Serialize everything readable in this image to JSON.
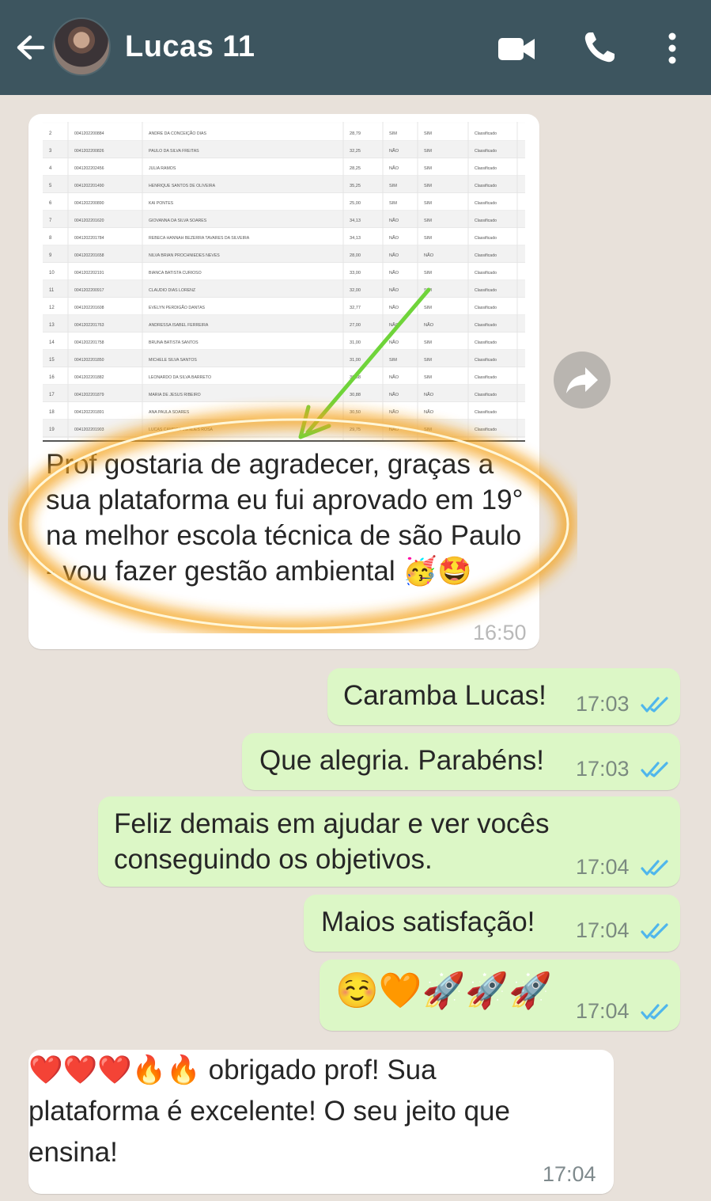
{
  "header": {
    "contact_name": "Lucas 11",
    "back_icon": "arrow-left-icon",
    "video_icon": "video-camera-icon",
    "call_icon": "phone-icon",
    "menu_icon": "more-vertical-icon",
    "bar_color": "#3d555f"
  },
  "messages": [
    {
      "direction": "incoming",
      "has_image": true,
      "text": "Prof gostaria de agradecer, graças a sua plataforma eu fui aprovado em 19° na melhor escola técnica de são Paulo - vou fazer gestão ambiental 🥳🤩",
      "time": "16:50"
    },
    {
      "direction": "outgoing",
      "text": "Caramba Lucas!",
      "time": "17:03",
      "status": "read"
    },
    {
      "direction": "outgoing",
      "text": "Que alegria. Parabéns!",
      "time": "17:03",
      "status": "read"
    },
    {
      "direction": "outgoing",
      "text": "Feliz demais em ajudar e ver vocês conseguindo os objetivos.",
      "time": "17:04",
      "status": "read"
    },
    {
      "direction": "outgoing",
      "text": "Maios satisfação!",
      "time": "17:04",
      "status": "read"
    },
    {
      "direction": "outgoing",
      "text": "☺️🧡🚀🚀🚀",
      "time": "17:04",
      "status": "read"
    },
    {
      "direction": "incoming",
      "text": "❤️❤️❤️🔥🔥 obrigado prof! Sua plataforma é excelente! O seu jeito que ensina!",
      "time": "17:04"
    }
  ],
  "screenshot_table": {
    "rows": [
      [
        "2",
        "0041202200884",
        "ANDRE DA CONCEIÇÃO DIAS",
        "28,79",
        "SIM",
        "SIM",
        "Classificado"
      ],
      [
        "3",
        "0041202200826",
        "PAULO DA SILVA FREITAS",
        "32,25",
        "NÃO",
        "SIM",
        "Classificado"
      ],
      [
        "4",
        "0041202202456",
        "JULIA RAMOS",
        "28,25",
        "NÃO",
        "SIM",
        "Classificado"
      ],
      [
        "5",
        "0041202201490",
        "HENRIQUE SANTOS DE OLIVEIRA",
        "35,25",
        "SIM",
        "SIM",
        "Classificado"
      ],
      [
        "6",
        "0041202200890",
        "KAI PONTES",
        "25,00",
        "SIM",
        "SIM",
        "Classificado"
      ],
      [
        "7",
        "0041202201620",
        "GIOVANNA DA SILVA SOARES",
        "34,13",
        "NÃO",
        "SIM",
        "Classificado"
      ],
      [
        "8",
        "0041202201784",
        "REBECA HANNAH BEZERRA TAVARES DA SILVEIRA",
        "34,13",
        "NÃO",
        "SIM",
        "Classificado"
      ],
      [
        "9",
        "0041202201658",
        "NILVA BRIAN PROCHNIEDES NEVES",
        "28,00",
        "NÃO",
        "NÃO",
        "Classificado"
      ],
      [
        "10",
        "0041202202191",
        "BIANCA BATISTA CURIOSO",
        "33,00",
        "NÃO",
        "SIM",
        "Classificado"
      ],
      [
        "11",
        "0041202200917",
        "CLAUDIO DIAS LORENZ",
        "32,00",
        "NÃO",
        "SIM",
        "Classificado"
      ],
      [
        "12",
        "0041202201608",
        "EVELYN PERDIGÃO DANTAS",
        "32,77",
        "NÃO",
        "SIM",
        "Classificado"
      ],
      [
        "13",
        "0041202201763",
        "ANDRESSA ISABEL FERREIRA",
        "27,00",
        "NÃO",
        "NÃO",
        "Classificado"
      ],
      [
        "14",
        "0041202201758",
        "BRUNA BATISTA SANTOS",
        "31,00",
        "NÃO",
        "SIM",
        "Classificado"
      ],
      [
        "15",
        "0041202201850",
        "MICHELE SILVA SANTOS",
        "31,00",
        "SIM",
        "SIM",
        "Classificado"
      ],
      [
        "16",
        "0041202201882",
        "LEONARDO DA SILVA BARRETO",
        "30,88",
        "NÃO",
        "SIM",
        "Classificado"
      ],
      [
        "17",
        "0041202201879",
        "MARIA DE JESUS RIBEIRO",
        "30,88",
        "NÃO",
        "NÃO",
        "Classificado"
      ],
      [
        "18",
        "0041202201891",
        "ANA PAULA SOARES",
        "30,50",
        "NÃO",
        "NÃO",
        "Classificado"
      ],
      [
        "19",
        "0041202201903",
        "LUCAS CAMPOS MENDES ROSA",
        "29,75",
        "NÃO",
        "SIM",
        "Classificado"
      ]
    ]
  },
  "icons": {
    "forward": "forward-arrow-icon",
    "read_receipt": "double-check-icon",
    "read_color": "#4fb6ec"
  }
}
